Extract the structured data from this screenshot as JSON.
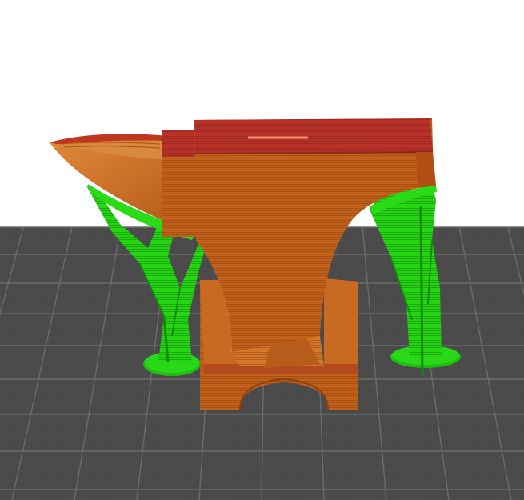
{
  "scene": {
    "background_color": "#ffffff",
    "build_plate_color": "#4a4a4a",
    "build_plate_grid_color": "#656565",
    "build_plate_fine_grid_color": "#585858",
    "model_color": "#c0621c",
    "model_highlight_color": "#d97a30",
    "model_top_color": "#b8322a",
    "support_color": "#22cc11",
    "support_shadow_color": "#138a0a"
  },
  "objects": [
    {
      "name": "anvil-model",
      "color": "#c0621c"
    },
    {
      "name": "support-structure-left",
      "color": "#22cc11"
    },
    {
      "name": "support-structure-right",
      "color": "#22cc11"
    }
  ]
}
